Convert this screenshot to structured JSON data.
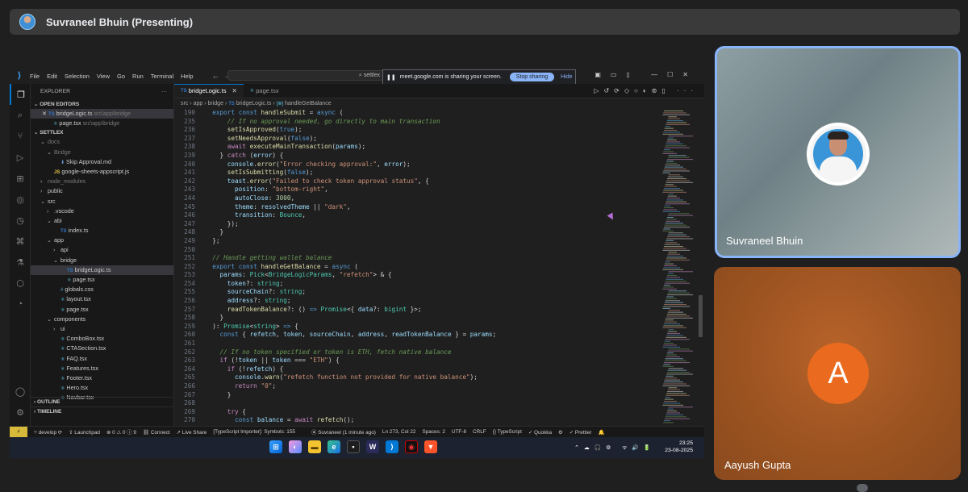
{
  "meet": {
    "presenter_title": "Suvraneel Bhuin (Presenting)",
    "participants": [
      {
        "name": "Suvraneel Bhuin"
      },
      {
        "name": "Aayush Gupta",
        "initial": "A"
      }
    ]
  },
  "share_banner": {
    "text": "meet.google.com is sharing your screen.",
    "stop_label": "Stop sharing",
    "hide_label": "Hide"
  },
  "vscode": {
    "menu": [
      "File",
      "Edit",
      "Selection",
      "View",
      "Go",
      "Run",
      "Terminal",
      "Help"
    ],
    "search_text": "settlex",
    "explorer_title": "EXPLORER",
    "open_editors_label": "OPEN EDITORS",
    "open_editors": [
      {
        "name": "bridgeLogic.ts",
        "path": "src\\app\\bridge",
        "badge": "TS"
      },
      {
        "name": "page.tsx",
        "path": "src\\app\\bridge",
        "badge": ""
      }
    ],
    "workspace_label": "SETTLEX",
    "tree": [
      {
        "label": "docs",
        "indent": 1,
        "chev": "v",
        "badge": "",
        "dim": true
      },
      {
        "label": "Bridge",
        "indent": 2,
        "chev": "v",
        "badge": "",
        "dim": true
      },
      {
        "label": "Skip Approval.md",
        "indent": 3,
        "chev": "",
        "badge": "md",
        "dim": false
      },
      {
        "label": "google-sheets-appscript.js",
        "indent": 2,
        "chev": "",
        "badge": "JS",
        "dim": false
      },
      {
        "label": "node_modules",
        "indent": 1,
        "chev": ">",
        "badge": "",
        "dim": true
      },
      {
        "label": "public",
        "indent": 1,
        "chev": ">",
        "badge": "",
        "dim": false
      },
      {
        "label": "src",
        "indent": 1,
        "chev": "v",
        "badge": "",
        "dim": false
      },
      {
        "label": ".vscode",
        "indent": 2,
        "chev": ">",
        "badge": "",
        "dim": false
      },
      {
        "label": "abi",
        "indent": 2,
        "chev": "v",
        "badge": "",
        "dim": false
      },
      {
        "label": "index.ts",
        "indent": 3,
        "chev": "",
        "badge": "TS",
        "dim": false
      },
      {
        "label": "app",
        "indent": 2,
        "chev": "v",
        "badge": "",
        "dim": false
      },
      {
        "label": "api",
        "indent": 3,
        "chev": ">",
        "badge": "",
        "dim": false
      },
      {
        "label": "bridge",
        "indent": 3,
        "chev": "v",
        "badge": "",
        "dim": false
      },
      {
        "label": "bridgeLogic.ts",
        "indent": 4,
        "chev": "",
        "badge": "TS",
        "dim": false,
        "selected": true
      },
      {
        "label": "page.tsx",
        "indent": 4,
        "chev": "",
        "badge": "tsx",
        "dim": false
      },
      {
        "label": "globals.css",
        "indent": 3,
        "chev": "",
        "badge": "css",
        "dim": false
      },
      {
        "label": "layout.tsx",
        "indent": 3,
        "chev": "",
        "badge": "tsx",
        "dim": false
      },
      {
        "label": "page.tsx",
        "indent": 3,
        "chev": "",
        "badge": "tsx",
        "dim": false
      },
      {
        "label": "components",
        "indent": 2,
        "chev": "v",
        "badge": "",
        "dim": false
      },
      {
        "label": "ui",
        "indent": 3,
        "chev": ">",
        "badge": "",
        "dim": false
      },
      {
        "label": "ComboBox.tsx",
        "indent": 3,
        "chev": "",
        "badge": "tsx",
        "dim": false
      },
      {
        "label": "CTASection.tsx",
        "indent": 3,
        "chev": "",
        "badge": "tsx",
        "dim": false
      },
      {
        "label": "FAQ.tsx",
        "indent": 3,
        "chev": "",
        "badge": "tsx",
        "dim": false
      },
      {
        "label": "Features.tsx",
        "indent": 3,
        "chev": "",
        "badge": "tsx",
        "dim": false
      },
      {
        "label": "Footer.tsx",
        "indent": 3,
        "chev": "",
        "badge": "tsx",
        "dim": false
      },
      {
        "label": "Hero.tsx",
        "indent": 3,
        "chev": "",
        "badge": "tsx",
        "dim": false
      },
      {
        "label": "Navbar.tsx",
        "indent": 3,
        "chev": "",
        "badge": "tsx",
        "dim": false
      }
    ],
    "outline_label": "OUTLINE",
    "timeline_label": "TIMELINE",
    "tabs": [
      {
        "label": "bridgeLogic.ts",
        "badge": "TS",
        "active": true
      },
      {
        "label": "page.tsx",
        "badge": "",
        "active": false
      }
    ],
    "breadcrumb": [
      "src",
      "app",
      "bridge",
      "bridgeLogic.ts",
      "handleGetBalance"
    ],
    "code": [
      {
        "n": "190",
        "html": "  <span class='kw'>export</span> <span class='kw'>const</span> <span class='fn'>handleSubmit</span> = <span class='kw'>async</span> ("
      },
      {
        "n": "235",
        "html": "      <span class='cm'>// If no approval needed, go directly to main transaction</span>"
      },
      {
        "n": "236",
        "html": "      <span class='fn'>setIsApproved</span>(<span class='kw'>true</span>);"
      },
      {
        "n": "237",
        "html": "      <span class='fn'>setNeedsApproval</span>(<span class='kw'>false</span>);"
      },
      {
        "n": "238",
        "html": "      <span class='kc'>await</span> <span class='fn'>executeMainTransaction</span>(<span class='pr'>params</span>);"
      },
      {
        "n": "239",
        "html": "    } <span class='kc'>catch</span> (<span class='pr'>error</span>) {"
      },
      {
        "n": "240",
        "html": "      <span class='pr'>console</span>.<span class='fn'>error</span>(<span class='str'>\"Error checking approval:\"</span>, <span class='pr'>error</span>);"
      },
      {
        "n": "241",
        "html": "      <span class='fn'>setIsSubmitting</span>(<span class='kw'>false</span>);"
      },
      {
        "n": "242",
        "html": "      <span class='pr'>toast</span>.<span class='fn'>error</span>(<span class='str'>\"Failed to check token approval status\"</span>, {"
      },
      {
        "n": "243",
        "html": "        <span class='pr'>position</span>: <span class='str'>\"bottom-right\"</span>,"
      },
      {
        "n": "244",
        "html": "        <span class='pr'>autoClose</span>: <span class='num'>3000</span>,"
      },
      {
        "n": "245",
        "html": "        <span class='pr'>theme</span>: <span class='pr'>resolvedTheme</span> || <span class='str'>\"dark\"</span>,"
      },
      {
        "n": "246",
        "html": "        <span class='pr'>transition</span>: <span class='ty'>Bounce</span>,"
      },
      {
        "n": "247",
        "html": "      });"
      },
      {
        "n": "248",
        "html": "    }"
      },
      {
        "n": "249",
        "html": "  };"
      },
      {
        "n": "250",
        "html": ""
      },
      {
        "n": "251",
        "html": "  <span class='cm'>// Handle getting wallet balance</span>"
      },
      {
        "n": "252",
        "html": "  <span class='kw'>export</span> <span class='kw'>const</span> <span class='fn'>handleGetBalance</span> = <span class='kw'>async</span> ("
      },
      {
        "n": "253",
        "html": "    <span class='pr'>params</span>: <span class='ty'>Pick</span>&lt;<span class='ty'>BridgeLogicParams</span>, <span class='str'>\"refetch\"</span>&gt; &amp; {"
      },
      {
        "n": "254",
        "html": "      <span class='pr'>token</span>?: <span class='ty'>string</span>;"
      },
      {
        "n": "255",
        "html": "      <span class='pr'>sourceChain</span>?: <span class='ty'>string</span>;"
      },
      {
        "n": "256",
        "html": "      <span class='pr'>address</span>?: <span class='ty'>string</span>;"
      },
      {
        "n": "257",
        "html": "      <span class='fn'>readTokenBalance</span>?: () <span class='kw'>=&gt;</span> <span class='ty'>Promise</span>&lt;{ <span class='pr'>data</span>?: <span class='ty'>bigint</span> }&gt;;"
      },
      {
        "n": "258",
        "html": "    }"
      },
      {
        "n": "259",
        "html": "  ): <span class='ty'>Promise</span>&lt;<span class='ty'>string</span>&gt; <span class='kw'>=&gt;</span> {"
      },
      {
        "n": "260",
        "html": "    <span class='kw'>const</span> { <span class='pr'>refetch</span>, <span class='pr'>token</span>, <span class='pr'>sourceChain</span>, <span class='pr'>address</span>, <span class='pr'>readTokenBalance</span> } = <span class='pr'>params</span>;"
      },
      {
        "n": "261",
        "html": ""
      },
      {
        "n": "262",
        "html": "    <span class='cm'>// If no token specified or token is ETH, fetch native balance</span>"
      },
      {
        "n": "263",
        "html": "    <span class='kc'>if</span> (!<span class='pr'>token</span> || <span class='pr'>token</span> === <span class='str'>\"ETH\"</span>) {"
      },
      {
        "n": "264",
        "html": "      <span class='kc'>if</span> (!<span class='pr'>refetch</span>) {"
      },
      {
        "n": "265",
        "html": "        <span class='pr'>console</span>.<span class='fn'>warn</span>(<span class='str'>\"refetch function not provided for native balance\"</span>);"
      },
      {
        "n": "266",
        "html": "        <span class='kc'>return</span> <span class='str'>\"0\"</span>;"
      },
      {
        "n": "267",
        "html": "      }"
      },
      {
        "n": "268",
        "html": ""
      },
      {
        "n": "269",
        "html": "      <span class='kc'>try</span> {"
      },
      {
        "n": "270",
        "html": "        <span class='kw'>const</span> <span class='pr'>balance</span> = <span class='kc'>await</span> <span class='fn'>refetch</span>();"
      }
    ],
    "status": {
      "branch": "develop",
      "launchpad": "Launchpad",
      "problems": "0 ⚠ 0 ⓘ 9",
      "connect": "Connect",
      "live_share": "Live Share",
      "importer": "[TypeScript Importer]: Symbols: 155",
      "author": "Suvraneel (1 minute ago)",
      "cursor": "Ln 273, Col 22",
      "spaces": "Spaces: 2",
      "encoding": "UTF-8",
      "eol": "CRLF",
      "language": "TypeScript",
      "quokka": "Quokka",
      "prettier": "Prettier"
    },
    "clock": {
      "time": "23:25",
      "date": "23-08-2025"
    }
  }
}
